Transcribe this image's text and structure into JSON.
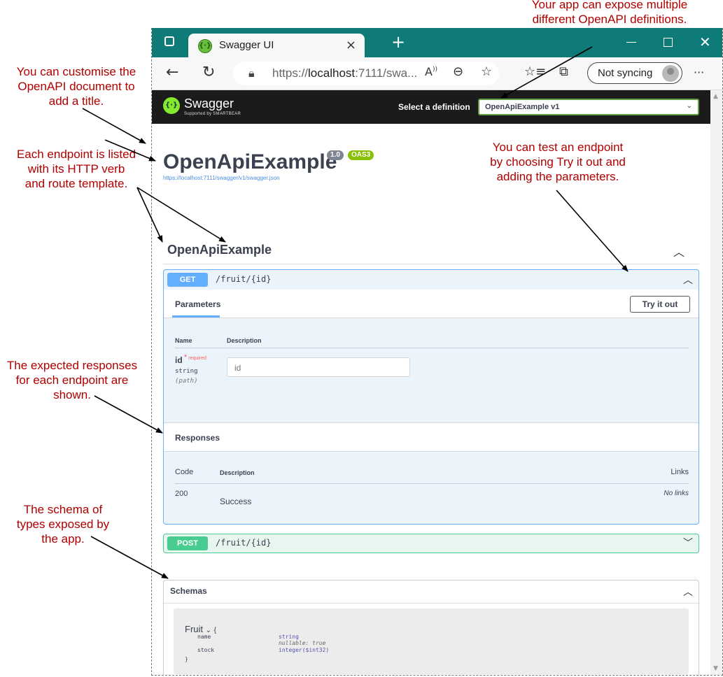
{
  "annotations": {
    "expose_definitions": [
      "Your app can expose multiple",
      "different OpenAPI definitions."
    ],
    "title": [
      "You can customise the",
      "OpenAPI document to",
      "add a title."
    ],
    "endpoints": [
      "Each endpoint is listed",
      "with its HTTP verb",
      "and route template."
    ],
    "try_it": [
      "You can test an endpoint",
      "by choosing Try it out and",
      "adding the parameters."
    ],
    "responses": [
      "The expected responses",
      "for each endpoint are",
      "shown."
    ],
    "schema": [
      "The schema of",
      "types exposed by",
      "the app."
    ]
  },
  "browser": {
    "tab_title": "Swagger UI",
    "tab_close": "×",
    "new_tab": "+",
    "address_prefix": "https://",
    "address_host": "localhost",
    "address_rest": ":7111/swa...",
    "sync_label": "Not syncing",
    "more": "···"
  },
  "swagger": {
    "brand": "Swagger",
    "brand_sub": "Supported by SMARTBEAR",
    "select_label": "Select a definition",
    "selected_definition": "OpenApiExample v1",
    "api_title": "OpenApiExample",
    "version_badge": "1.0",
    "oas_badge": "OAS3",
    "spec_url": "https://localhost:7111/swagger/v1/swagger.json",
    "section_title": "OpenApiExample",
    "get_op": {
      "verb": "GET",
      "path": "/fruit/{id}",
      "params_tab": "Parameters",
      "try_button": "Try it out",
      "col_name": "Name",
      "col_description": "Description",
      "param_name": "id",
      "param_required_star": "*",
      "param_required": "required",
      "param_type": "string",
      "param_in": "(path)",
      "param_placeholder": "id",
      "responses_title": "Responses",
      "resp_col_code": "Code",
      "resp_col_description": "Description",
      "resp_col_links": "Links",
      "resp_code": "200",
      "resp_description": "Success",
      "resp_links": "No links"
    },
    "post_op": {
      "verb": "POST",
      "path": "/fruit/{id}"
    },
    "schemas": {
      "title": "Schemas",
      "model_name": "Fruit",
      "open_brace": "{",
      "close_brace": "}",
      "fields": [
        {
          "name": "name",
          "type": "string",
          "note": "nullable: true"
        },
        {
          "name": "stock",
          "type": "integer($int32)",
          "note": ""
        }
      ]
    }
  },
  "colors": {
    "annotation": "#b00000",
    "titlebar": "#0f7b78",
    "get": "#61affe",
    "post": "#49cc90",
    "swagger_top": "#1b1b1b"
  }
}
